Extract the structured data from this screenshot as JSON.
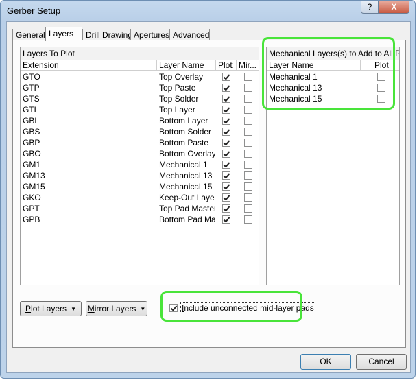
{
  "window": {
    "title": "Gerber Setup",
    "help_glyph": "?",
    "close_glyph": "X"
  },
  "tabs": [
    "General",
    "Layers",
    "Drill Drawing",
    "Apertures",
    "Advanced"
  ],
  "active_tab": "Layers",
  "layers_to_plot": {
    "title": "Layers To Plot",
    "columns": {
      "extension": "Extension",
      "layer_name": "Layer Name",
      "plot": "Plot",
      "mirror": "Mir..."
    },
    "rows": [
      {
        "ext": "GTO",
        "name": "Top Overlay",
        "plot": true,
        "mirror": false
      },
      {
        "ext": "GTP",
        "name": "Top Paste",
        "plot": true,
        "mirror": false
      },
      {
        "ext": "GTS",
        "name": "Top Solder",
        "plot": true,
        "mirror": false
      },
      {
        "ext": "GTL",
        "name": "Top Layer",
        "plot": true,
        "mirror": false
      },
      {
        "ext": "GBL",
        "name": "Bottom Layer",
        "plot": true,
        "mirror": false
      },
      {
        "ext": "GBS",
        "name": "Bottom Solder",
        "plot": true,
        "mirror": false
      },
      {
        "ext": "GBP",
        "name": "Bottom Paste",
        "plot": true,
        "mirror": false
      },
      {
        "ext": "GBO",
        "name": "Bottom Overlay",
        "plot": true,
        "mirror": false
      },
      {
        "ext": "GM1",
        "name": "Mechanical 1",
        "plot": true,
        "mirror": false
      },
      {
        "ext": "GM13",
        "name": "Mechanical 13",
        "plot": true,
        "mirror": false
      },
      {
        "ext": "GM15",
        "name": "Mechanical 15",
        "plot": true,
        "mirror": false
      },
      {
        "ext": "GKO",
        "name": "Keep-Out Layer",
        "plot": true,
        "mirror": false
      },
      {
        "ext": "GPT",
        "name": "Top Pad Master",
        "plot": true,
        "mirror": false
      },
      {
        "ext": "GPB",
        "name": "Bottom Pad Master",
        "plot": true,
        "mirror": false
      }
    ]
  },
  "mechanical_layers": {
    "title": "Mechanical Layers(s) to Add to All Plots",
    "columns": {
      "layer_name": "Layer Name",
      "plot": "Plot"
    },
    "rows": [
      {
        "name": "Mechanical 1",
        "plot": false
      },
      {
        "name": "Mechanical 13",
        "plot": false
      },
      {
        "name": "Mechanical 15",
        "plot": false
      }
    ]
  },
  "buttons": {
    "plot_layers_first": "P",
    "plot_layers_rest": "lot Layers",
    "mirror_layers_first": "M",
    "mirror_layers_rest": "irror Layers",
    "dropdown_glyph": "▼",
    "ok": "OK",
    "cancel": "Cancel"
  },
  "include_unconnected": {
    "label_first": "I",
    "label_rest": "nclude unconnected mid-layer pads",
    "checked": true
  },
  "colors": {
    "highlight": "#49e43a",
    "window_frame": "#bdd3ea"
  }
}
